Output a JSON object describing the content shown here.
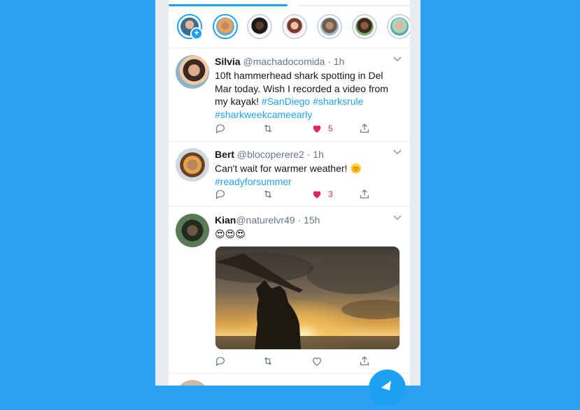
{
  "colors": {
    "background": "#2aa1f2",
    "accent": "#1da1f2",
    "like": "#e0245e",
    "muted": "#657786",
    "text": "#14171a"
  },
  "tweets": [
    {
      "name": "Silvia",
      "handle": "@machadocomida",
      "time": "· 1h",
      "text": "10ft hammerhead shark spotting in Del Mar today. Wish I recorded a video from my kayak!",
      "hashtags": [
        "#SanDiego",
        "#sharksrule",
        "#sharkweekcameearly"
      ],
      "likes": "5",
      "liked": true
    },
    {
      "name": "Bert",
      "handle": "@blocoperere2",
      "time": "· 1h",
      "text": "Can't wait for warmer weather!",
      "emoji": "🌞",
      "hashtags": [
        "#readyforsummer"
      ],
      "likes": "3",
      "liked": true
    },
    {
      "name": "Kian",
      "handle": "@naturelvr49",
      "time": "· 15h",
      "text": "😍😍😍",
      "liked": false
    }
  ],
  "icons": [
    "reply-icon",
    "retweet-icon",
    "like-icon",
    "share-icon",
    "chevron-down-icon",
    "compose-icon",
    "add-fleet-icon"
  ]
}
